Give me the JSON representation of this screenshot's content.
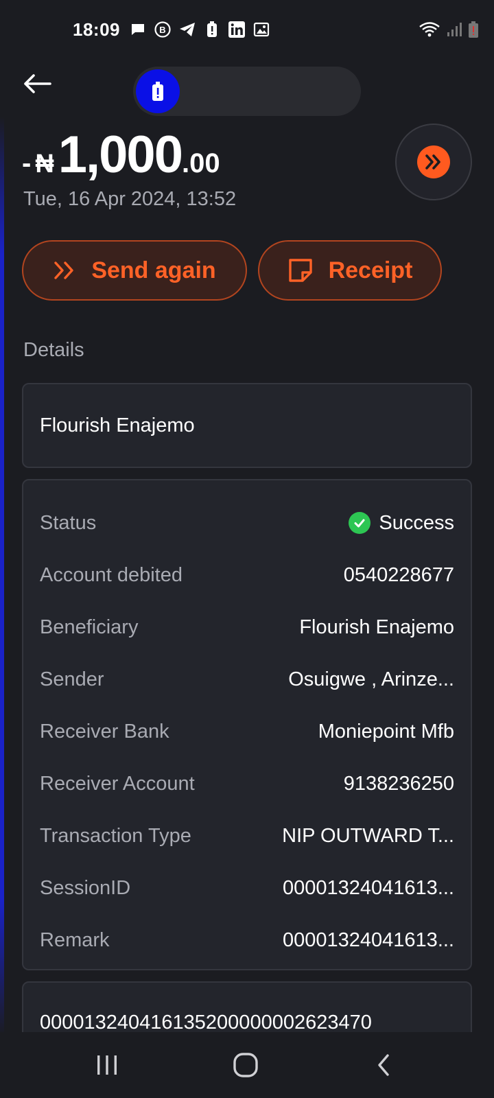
{
  "status_bar": {
    "time": "18:09",
    "left_icons": [
      "message-icon",
      "b-circle-icon",
      "telegram-icon",
      "alert-battery-icon",
      "linkedin-icon",
      "image-icon"
    ],
    "right_icons": [
      "wifi-icon",
      "signal-icon",
      "battery-icon"
    ]
  },
  "transaction": {
    "minus": "-",
    "currency": "₦",
    "amount_main": "1,000",
    "amount_decimal": ".00",
    "datetime": "Tue, 16 Apr 2024, 13:52"
  },
  "actions": {
    "send_again": "Send again",
    "receipt": "Receipt"
  },
  "details_label": "Details",
  "name_card": "Flourish Enajemo",
  "details": [
    {
      "key": "Status",
      "value": "Success"
    },
    {
      "key": "Account debited",
      "value": "0540228677"
    },
    {
      "key": "Beneficiary",
      "value": "Flourish Enajemo"
    },
    {
      "key": "Sender",
      "value": "Osuigwe , Arinze..."
    },
    {
      "key": "Receiver Bank",
      "value": "Moniepoint Mfb"
    },
    {
      "key": "Receiver Account",
      "value": "9138236250"
    },
    {
      "key": "Transaction Type",
      "value": "NIP OUTWARD T..."
    },
    {
      "key": "SessionID",
      "value": "00001324041613..."
    },
    {
      "key": "Remark",
      "value": "00001324041613..."
    }
  ],
  "remark_full": "000013240416135200000002623470",
  "colors": {
    "background": "#1b1c21",
    "accent": "#ff5a1f",
    "success": "#2dc653",
    "card": "#23252c"
  }
}
